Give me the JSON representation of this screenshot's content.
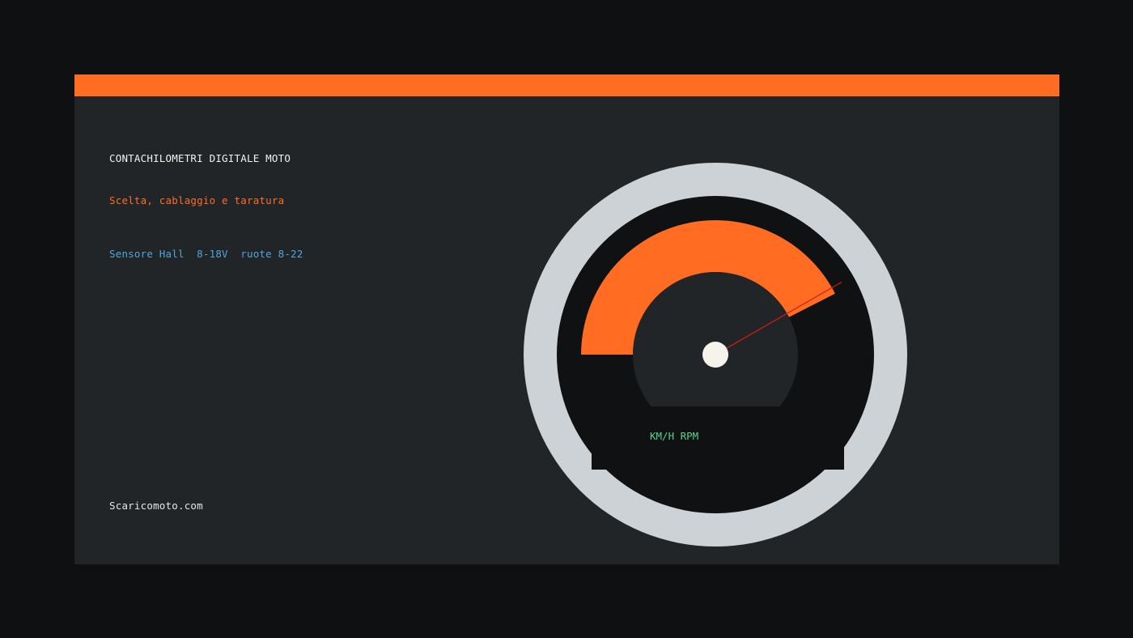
{
  "title": "CONTACHILOMETRI DIGITALE MOTO",
  "subtitle": "Scelta, cablaggio e taratura",
  "specs": "Sensore Hall  8-18V  ruote 8-22",
  "site": "Scaricomoto.com",
  "gauge": {
    "unit_label": "KM/H RPM",
    "level": 0.85
  },
  "colors": {
    "page_bg": "#0e1012",
    "card_bg": "#222528",
    "accent": "#ff6c22",
    "title_text": "#f2f2f2",
    "subtitle_text": "#ff6c22",
    "specs_text": "#4ea6d8",
    "site_text": "#e6e6e6",
    "bezel": "#ccd2d6",
    "dial_face": "#0f1113",
    "needle": "#d41c10",
    "hub": "#f5f3ea",
    "unit_label": "#58d28c"
  }
}
